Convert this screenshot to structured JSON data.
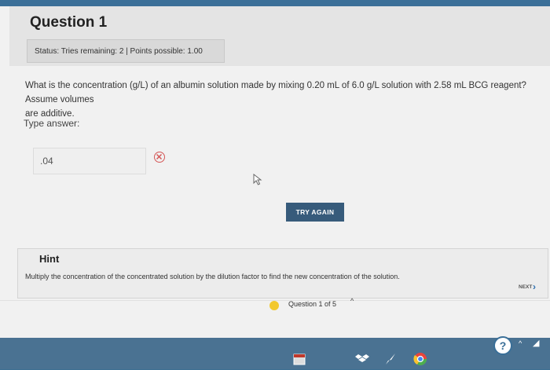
{
  "question": {
    "title": "Question 1",
    "status": "Status: Tries remaining: 2 | Points possible: 1.00",
    "text_main": "What is the concentration (g/L) of an albumin solution made by mixing 0.20 mL of 6.0 g/L solution with 2.58 mL BCG reagent? Assume volumes",
    "text_continued": "are additive.",
    "type_answer_label": "Type answer:",
    "answer_value": ".04",
    "answer_state": "incorrect"
  },
  "actions": {
    "try_again_label": "TRY AGAIN"
  },
  "hint": {
    "title": "Hint",
    "text": "Multiply the concentration of the concentrated solution by the dilution factor to find the new concentration of the solution."
  },
  "navigation": {
    "next_label": "NEXT",
    "counter": "Question 1 of 5"
  },
  "colors": {
    "primary": "#375b7b",
    "error": "#d45555",
    "progress_dot": "#f2c82e",
    "taskbar": "#4a7292"
  }
}
